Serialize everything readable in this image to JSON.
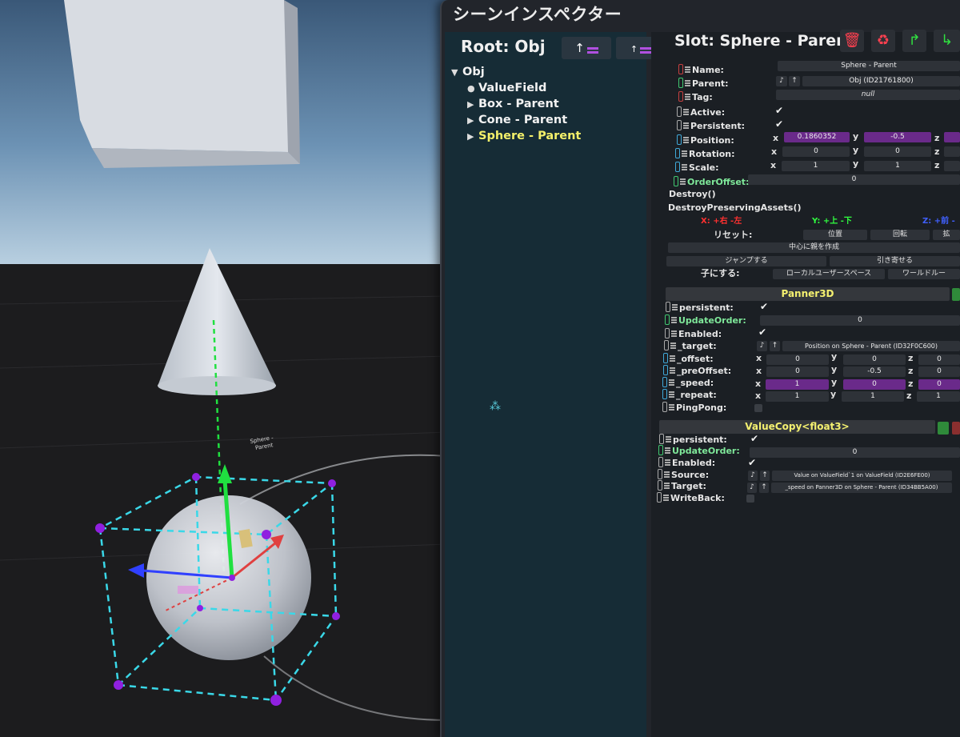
{
  "panel": {
    "title": "シーンインスペクター"
  },
  "hierarchy": {
    "root_label": "Root: Obj",
    "buttons": [
      "↑",
      "↑"
    ],
    "items": [
      {
        "glyph": "▼",
        "label": "Obj",
        "indent": 0,
        "selected": false
      },
      {
        "glyph": "●",
        "label": "ValueField",
        "indent": 1,
        "selected": false
      },
      {
        "glyph": "▶",
        "label": "Box - Parent",
        "indent": 1,
        "selected": false
      },
      {
        "glyph": "▶",
        "label": "Cone - Parent",
        "indent": 1,
        "selected": false
      },
      {
        "glyph": "▶",
        "label": "Sphere - Parent",
        "indent": 1,
        "selected": true
      }
    ]
  },
  "inspector": {
    "slot_title": "Slot: Sphere - Parent",
    "name_label": "Name:",
    "name_value": "Sphere - Parent",
    "parent_label": "Parent:",
    "parent_value": "Obj (ID21761800)",
    "tag_label": "Tag:",
    "tag_value": "null",
    "active_label": "Active:",
    "persistent_label": "Persistent:",
    "position_label": "Position:",
    "position": {
      "x": "0.1860352",
      "y": "-0.5",
      "z": ""
    },
    "rotation_label": "Rotation:",
    "rotation": {
      "x": "0",
      "y": "0",
      "z": ""
    },
    "scale_label": "Scale:",
    "scale": {
      "x": "1",
      "y": "1",
      "z": ""
    },
    "orderoffset_label": "OrderOffset:",
    "orderoffset_value": "0",
    "destroy": "Destroy()",
    "destroy_preserving": "DestroyPreservingAssets()",
    "axis_x": "X: +右 -左",
    "axis_y": "Y: +上 -下",
    "axis_z": "Z: +前 -",
    "reset_label": "リセット:",
    "reset_pos": "位置",
    "reset_rot": "回転",
    "reset_scale": "拡",
    "create_parent": "中心に親を作成",
    "jump": "ジャンプする",
    "pull": "引き寄せる",
    "child_label": "子にする:",
    "local_space": "ローカルユーザースペース",
    "world": "ワールドルー",
    "axis_letters": {
      "x": "x",
      "y": "y",
      "z": "z"
    }
  },
  "panner": {
    "header": "Panner3D",
    "persistent_label": "persistent:",
    "updateorder_label": "UpdateOrder:",
    "updateorder_value": "0",
    "enabled_label": "Enabled:",
    "target_label": "_target:",
    "target_value": "Position on Sphere - Parent (ID32F0C600)",
    "offset_label": "_offset:",
    "offset": {
      "x": "0",
      "y": "0",
      "z": "0"
    },
    "preoffset_label": "_preOffset:",
    "preoffset": {
      "x": "0",
      "y": "-0.5",
      "z": "0"
    },
    "speed_label": "_speed:",
    "speed": {
      "x": "1",
      "y": "0",
      "z": "0"
    },
    "repeat_label": "_repeat:",
    "repeat": {
      "x": "1",
      "y": "1",
      "z": "1"
    },
    "pingpong_label": "PingPong:"
  },
  "valuecopy": {
    "header": "ValueCopy<float3>",
    "persistent_label": "persistent:",
    "updateorder_label": "UpdateOrder:",
    "updateorder_value": "0",
    "enabled_label": "Enabled:",
    "source_label": "Source:",
    "source_value": "Value on ValueField`1 on ValueField (ID2E6FE00)",
    "target_label": "Target:",
    "target_value": "_speed on Panner3D on Sphere - Parent (ID34BB5A00)",
    "writeback_label": "WriteBack:"
  },
  "scene": {
    "sphere_label_1": "Sphere -",
    "sphere_label_2": "Parent"
  },
  "colors": {
    "accent": "#f4f06a",
    "purple": "#6a2a8a",
    "gizmo_cyan": "#3ad8e8",
    "gizmo_purple": "#9020e0"
  }
}
